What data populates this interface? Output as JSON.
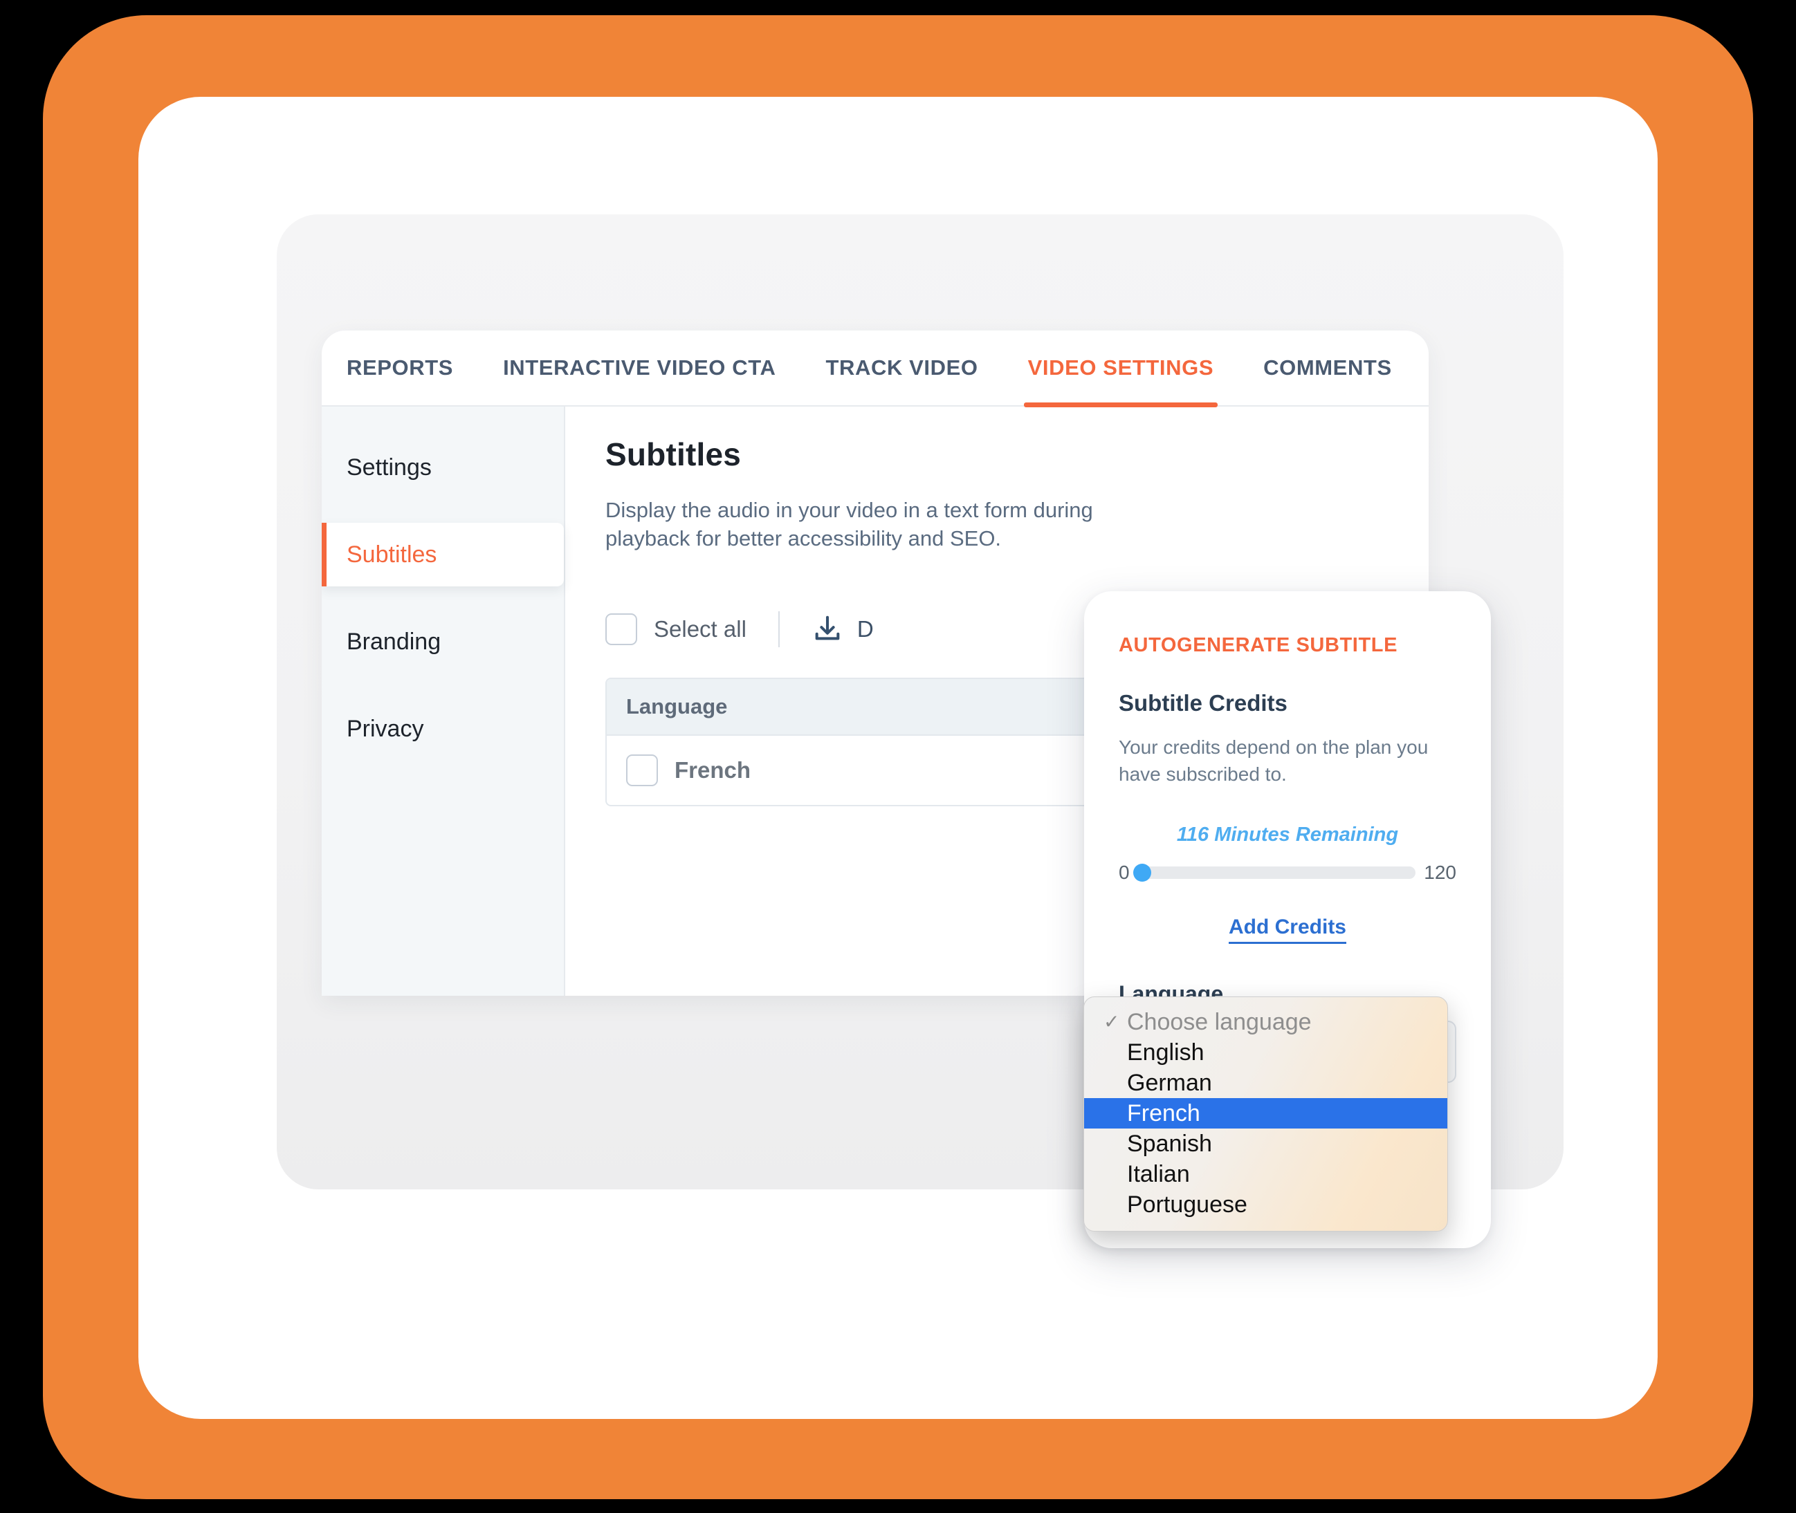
{
  "frame": {
    "accent_color": "#F08437",
    "background_color": "#000000",
    "card_color": "#FFFFFF"
  },
  "tabs": [
    {
      "label": "REPORTS",
      "active": false
    },
    {
      "label": "INTERACTIVE VIDEO CTA",
      "active": false
    },
    {
      "label": "TRACK VIDEO",
      "active": false
    },
    {
      "label": "VIDEO SETTINGS",
      "active": true
    },
    {
      "label": "COMMENTS",
      "active": false
    }
  ],
  "sidebar": {
    "items": [
      {
        "label": "Settings",
        "active": false
      },
      {
        "label": "Subtitles",
        "active": true
      },
      {
        "label": "Branding",
        "active": false
      },
      {
        "label": "Privacy",
        "active": false
      }
    ]
  },
  "main": {
    "title": "Subtitles",
    "description": "Display the audio in your video in a text form during playback for better accessibility and SEO.",
    "select_all_label": "Select all",
    "download_label": "D",
    "download_icon": "download-icon",
    "table": {
      "header": "Language",
      "rows": [
        {
          "language": "French",
          "checked": false
        }
      ]
    }
  },
  "popup": {
    "kicker": "AUTOGENERATE SUBTITLE",
    "credits_title": "Subtitle Credits",
    "credits_description": "Your credits depend on the plan you have subscribed to.",
    "minutes_remaining": "116 Minutes Remaining",
    "slider": {
      "min_label": "0",
      "max_label": "120",
      "min": 0,
      "max": 120,
      "value": 2
    },
    "add_credits_label": "Add Credits",
    "language_label": "Language",
    "accent_color": "#F4673D",
    "link_color": "#2C6FD1",
    "credits_color": "#4FADF0"
  },
  "dropdown": {
    "options": [
      {
        "label": "Choose language",
        "placeholder": true,
        "checked": true,
        "selected": false
      },
      {
        "label": "English",
        "placeholder": false,
        "checked": false,
        "selected": false
      },
      {
        "label": "German",
        "placeholder": false,
        "checked": false,
        "selected": false
      },
      {
        "label": "French",
        "placeholder": false,
        "checked": false,
        "selected": true
      },
      {
        "label": "Spanish",
        "placeholder": false,
        "checked": false,
        "selected": false
      },
      {
        "label": "Italian",
        "placeholder": false,
        "checked": false,
        "selected": false
      },
      {
        "label": "Portuguese",
        "placeholder": false,
        "checked": false,
        "selected": false
      }
    ],
    "highlight_color": "#2A72E8",
    "checkmark": "✓"
  }
}
